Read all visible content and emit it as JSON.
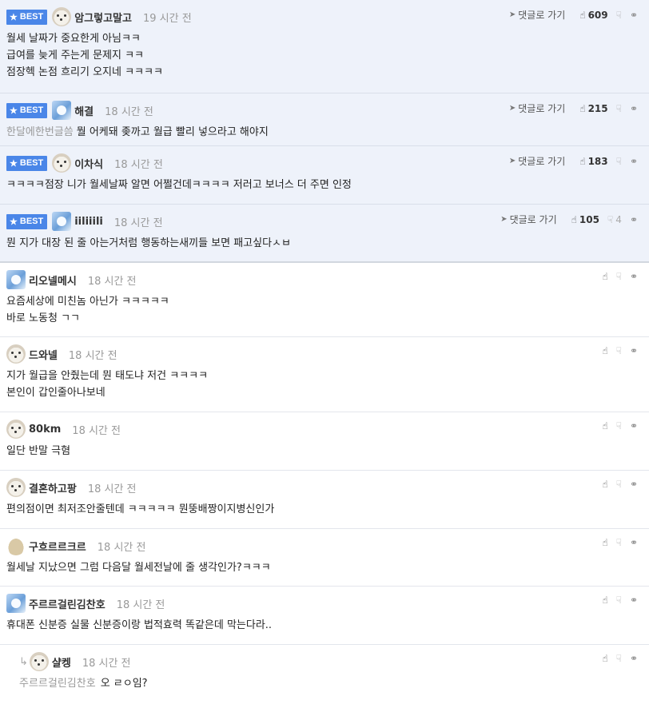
{
  "labels": {
    "best": "BEST",
    "reply_link": "댓글로 가기"
  },
  "colors": {
    "best_bg": "#eef2fa",
    "badge": "#4a86e8"
  },
  "best_comments": [
    {
      "avatar": "dog",
      "nick": "암그렇고말고",
      "time": "19 시간 전",
      "up": "609",
      "down": "",
      "lines": [
        "월세 날짜가 중요한게 아님ㅋㅋ",
        "급여를 늦게 주는게 문제지 ㅋㅋ",
        "점장헥 논점 흐리기 오지네 ㅋㅋㅋㅋ"
      ]
    },
    {
      "avatar": "blue",
      "nick": "해결",
      "time": "18 시간 전",
      "up": "215",
      "down": "",
      "lines": [
        "한달에한번글씀 뭘 어케돼 좆까고 월급 빨리 넣으라고 해야지"
      ],
      "faded_prefix": "한달에한번글씀"
    },
    {
      "avatar": "dog",
      "nick": "이차식",
      "time": "18 시간 전",
      "up": "183",
      "down": "",
      "lines": [
        "ㅋㅋㅋㅋ점장 니가 월세날짜 알면 어쩔건데ㅋㅋㅋㅋ 저러고 보너스 더 주면 인정"
      ]
    },
    {
      "avatar": "blue",
      "nick": "iiliiili",
      "time": "18 시간 전",
      "up": "105",
      "down": "4",
      "lines": [
        "뭔 지가 대장 된 줄 아는거처럼 행동하는새끼들 보면 패고싶다ㅅㅂ"
      ]
    }
  ],
  "comments": [
    {
      "avatar": "blue",
      "nick": "리오넬메시",
      "time": "18 시간 전",
      "lines": [
        "요즘세상에 미친놈 아닌가 ㅋㅋㅋㅋㅋ",
        "바로 노동청 ㄱㄱ"
      ]
    },
    {
      "avatar": "dog",
      "nick": "드와넬",
      "time": "18 시간 전",
      "lines": [
        "지가 월급을 안줬는데 뭔 태도냐 저건 ㅋㅋㅋㅋ",
        "본인이 갑인줄아나보네"
      ]
    },
    {
      "avatar": "dog",
      "nick": "80km",
      "time": "18 시간 전",
      "lines": [
        "일단 반말 극혐"
      ]
    },
    {
      "avatar": "dog",
      "nick": "결혼하고팡",
      "time": "18 시간 전",
      "lines": [
        "편의점이면 최저조안줄텐데 ㅋㅋㅋㅋㅋ 뭔뚱배짱이지병신인가"
      ]
    },
    {
      "avatar": "rock",
      "nick": "구흐르르크르",
      "time": "18 시간 전",
      "lines": [
        "월세날 지났으면 그럼 다음달 월세전날에 줄 생각인가?ㅋㅋㅋ"
      ]
    },
    {
      "avatar": "blue",
      "nick": "주르르걸린김찬호",
      "time": "18 시간 전",
      "lines": [
        "휴대폰 신분증 실물 신분증이랑 법적효력 똑같은데 막는다라.."
      ]
    }
  ],
  "reply": {
    "avatar": "dog",
    "nick": "샬켕",
    "time": "18 시간 전",
    "mention": "주르르걸린김찬호",
    "text": "오 ㄹㅇ임?"
  }
}
